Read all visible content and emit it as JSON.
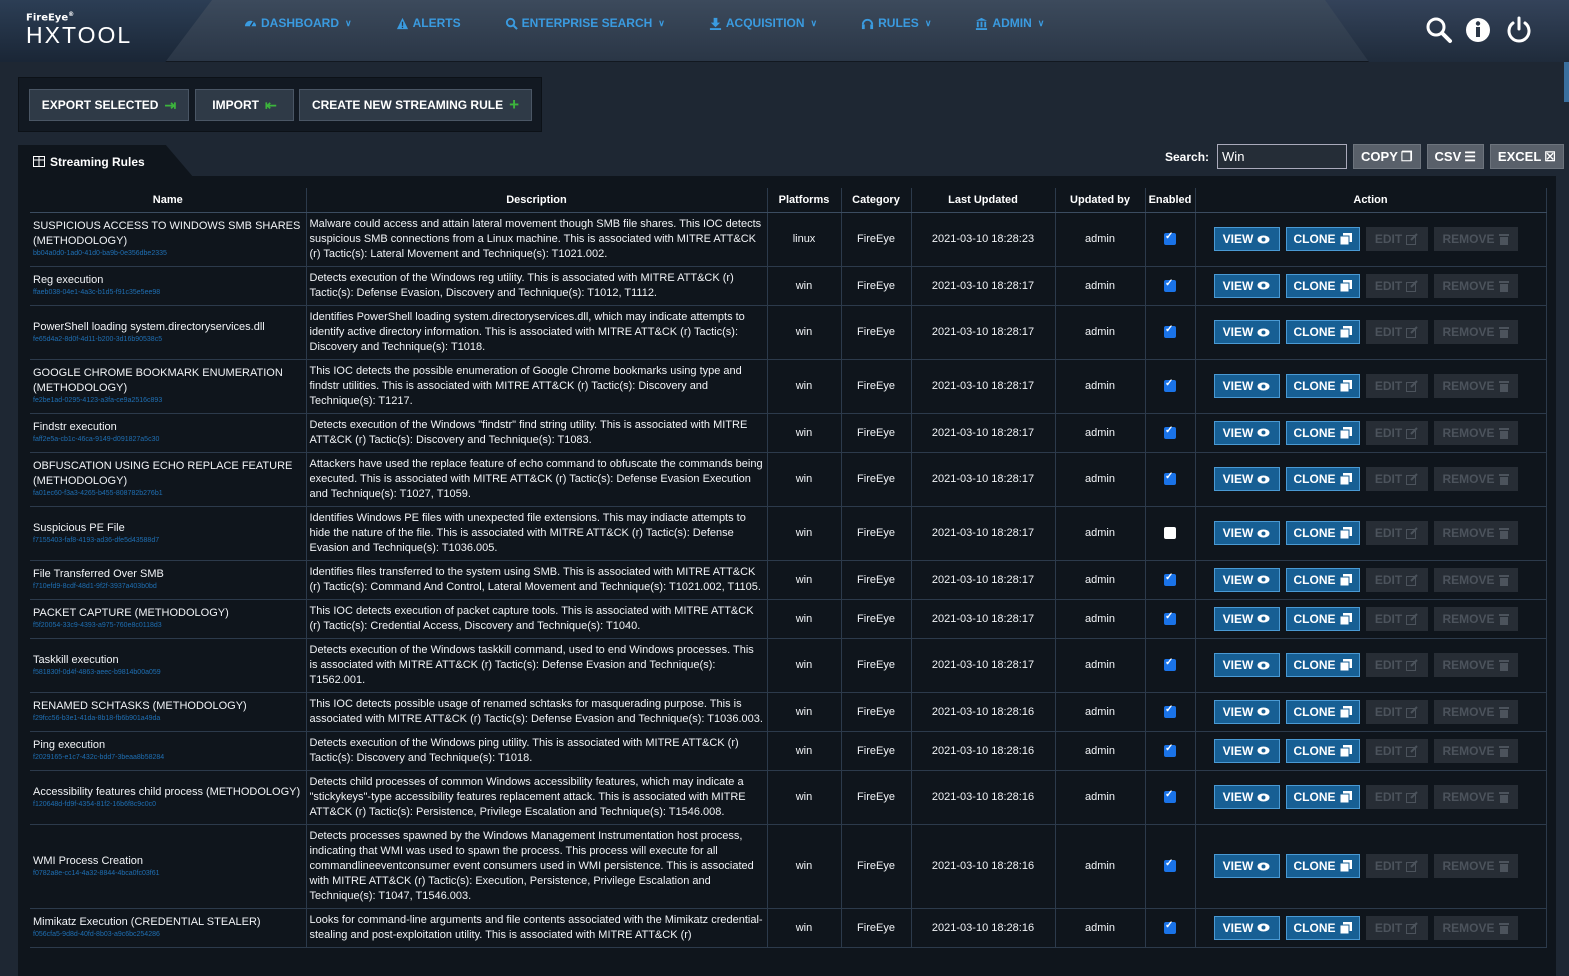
{
  "brand": {
    "vendor": "FireEye",
    "reg": "®",
    "product": "HXTOOL"
  },
  "nav": [
    {
      "label": "DASHBOARD",
      "icon": "dashboard-icon",
      "dropdown": true
    },
    {
      "label": "ALERTS",
      "icon": "warning-icon",
      "dropdown": false
    },
    {
      "label": "ENTERPRISE SEARCH",
      "icon": "search-icon",
      "dropdown": true
    },
    {
      "label": "ACQUISITION",
      "icon": "download-icon",
      "dropdown": true
    },
    {
      "label": "RULES",
      "icon": "headset-icon",
      "dropdown": true
    },
    {
      "label": "ADMIN",
      "icon": "bank-icon",
      "dropdown": true
    }
  ],
  "toolbar": {
    "export_label": "EXPORT SELECTED",
    "import_label": "IMPORT",
    "create_label": "CREATE NEW STREAMING RULE"
  },
  "panel": {
    "title": "Streaming Rules"
  },
  "search": {
    "label": "Search:",
    "value": "Win"
  },
  "export_buttons": {
    "copy": "COPY",
    "csv": "CSV",
    "excel": "EXCEL"
  },
  "columns": [
    "Name",
    "Description",
    "Platforms",
    "Category",
    "Last Updated",
    "Updated by",
    "Enabled",
    "Action"
  ],
  "actions": {
    "view": "VIEW",
    "clone": "CLONE",
    "edit": "EDIT",
    "remove": "REMOVE"
  },
  "colors": {
    "accent": "#3a9be0",
    "primary_button": "#175f94",
    "green_icon": "#3cb43c"
  },
  "rows": [
    {
      "name": "SUSPICIOUS ACCESS TO WINDOWS SMB SHARES (METHODOLOGY)",
      "id": "bb04a0d0-1ad0-41d0-ba9b-0e356dbe2335",
      "description": "Malware could access and attain lateral movement though SMB file shares. This IOC detects suspicious SMB connections from a Linux machine. This is associated with MITRE ATT&CK (r) Tactic(s): Lateral Movement and Technique(s): T1021.002.",
      "platform": "linux",
      "category": "FireEye",
      "updated": "2021-03-10 18:28:23",
      "by": "admin",
      "enabled": true
    },
    {
      "name": "Reg execution",
      "id": "ffaeb038-04e1-4a3c-b1d5-f91c35e5ee98",
      "description": "Detects execution of the Windows reg utility. This is associated with MITRE ATT&CK (r) Tactic(s): Defense Evasion, Discovery and Technique(s): T1012, T1112.",
      "platform": "win",
      "category": "FireEye",
      "updated": "2021-03-10 18:28:17",
      "by": "admin",
      "enabled": true
    },
    {
      "name": "PowerShell loading system.directoryservices.dll",
      "id": "fe65d4a2-8d0f-4d11-b200-3d16b90538c5",
      "description": "Identifies PowerShell loading system.directoryservices.dll, which may indicate attempts to identify active directory information. This is associated with MITRE ATT&CK (r) Tactic(s): Discovery and Technique(s): T1018.",
      "platform": "win",
      "category": "FireEye",
      "updated": "2021-03-10 18:28:17",
      "by": "admin",
      "enabled": true
    },
    {
      "name": "GOOGLE CHROME BOOKMARK ENUMERATION (METHODOLOGY)",
      "id": "fe2be1ad-0295-4123-a3fa-ce9a2516c893",
      "description": "This IOC detects the possible enumeration of Google Chrome bookmarks using type and findstr utilities. This is associated with MITRE ATT&CK (r) Tactic(s): Discovery and Technique(s): T1217.",
      "platform": "win",
      "category": "FireEye",
      "updated": "2021-03-10 18:28:17",
      "by": "admin",
      "enabled": true
    },
    {
      "name": "Findstr execution",
      "id": "faff2e5a-cb1c-46ca-9149-d091827a5c30",
      "description": "Detects execution of the Windows \"findstr\" find string utility. This is associated with MITRE ATT&CK (r) Tactic(s): Discovery and Technique(s): T1083.",
      "platform": "win",
      "category": "FireEye",
      "updated": "2021-03-10 18:28:17",
      "by": "admin",
      "enabled": true
    },
    {
      "name": "OBFUSCATION USING ECHO REPLACE FEATURE (METHODOLOGY)",
      "id": "fa01ec60-f3a3-4265-b455-808782b276b1",
      "description": "Attackers have used the replace feature of echo command to obfuscate the commands being executed. This is associated with MITRE ATT&CK (r) Tactic(s): Defense Evasion Execution and Technique(s): T1027, T1059.",
      "platform": "win",
      "category": "FireEye",
      "updated": "2021-03-10 18:28:17",
      "by": "admin",
      "enabled": true
    },
    {
      "name": "Suspicious PE File",
      "id": "f7155403-faf8-4193-ad36-dfe5d43588d7",
      "description": "Identifies Windows PE files with unexpected file extensions. This may indiacte attempts to hide the nature of the file. This is associated with MITRE ATT&CK (r) Tactic(s): Defense Evasion and Technique(s): T1036.005.",
      "platform": "win",
      "category": "FireEye",
      "updated": "2021-03-10 18:28:17",
      "by": "admin",
      "enabled": false
    },
    {
      "name": "File Transferred Over SMB",
      "id": "f710efd9-8cdf-48d1-9f2f-3937a403b0bd",
      "description": "Identifies files transferred to the system using SMB. This is associated with MITRE ATT&CK (r) Tactic(s): Command And Control, Lateral Movement and Technique(s): T1021.002, T1105.",
      "platform": "win",
      "category": "FireEye",
      "updated": "2021-03-10 18:28:17",
      "by": "admin",
      "enabled": true
    },
    {
      "name": "PACKET CAPTURE (METHODOLOGY)",
      "id": "f5f20054-33c9-4393-a975-760e8c0118d3",
      "description": "This IOC detects execution of packet capture tools. This is associated with MITRE ATT&CK (r) Tactic(s): Credential Access, Discovery and Technique(s): T1040.",
      "platform": "win",
      "category": "FireEye",
      "updated": "2021-03-10 18:28:17",
      "by": "admin",
      "enabled": true
    },
    {
      "name": "Taskkill execution",
      "id": "f581830f-0d4f-4863-aeec-b9814b00a059",
      "description": "Detects execution of the Windows taskkill command, used to end Windows processes. This is associated with MITRE ATT&CK (r) Tactic(s): Defense Evasion and Technique(s): T1562.001.",
      "platform": "win",
      "category": "FireEye",
      "updated": "2021-03-10 18:28:17",
      "by": "admin",
      "enabled": true
    },
    {
      "name": "RENAMED SCHTASKS (METHODOLOGY)",
      "id": "f29fcc56-b3e1-41da-8b18-fb6b901a49da",
      "description": "This IOC detects possible usage of renamed schtasks for masquerading purpose. This is associated with MITRE ATT&CK (r) Tactic(s): Defense Evasion and Technique(s): T1036.003.",
      "platform": "win",
      "category": "FireEye",
      "updated": "2021-03-10 18:28:16",
      "by": "admin",
      "enabled": true
    },
    {
      "name": "Ping execution",
      "id": "f2029165-e1c7-432c-bdd7-3beaa8b58284",
      "description": "Detects execution of the Windows ping utility. This is associated with MITRE ATT&CK (r) Tactic(s): Discovery and Technique(s): T1018.",
      "platform": "win",
      "category": "FireEye",
      "updated": "2021-03-10 18:28:16",
      "by": "admin",
      "enabled": true
    },
    {
      "name": "Accessibility features child process (METHODOLOGY)",
      "id": "f120648d-fd9f-4354-81f2-16b6f8c9c0c0",
      "description": "Detects child processes of common Windows accessibility features, which may indicate a \"stickykeys\"-type accessibility features replacement attack. This is associated with MITRE ATT&CK (r) Tactic(s): Persistence, Privilege Escalation and Technique(s): T1546.008.",
      "platform": "win",
      "category": "FireEye",
      "updated": "2021-03-10 18:28:16",
      "by": "admin",
      "enabled": true
    },
    {
      "name": "WMI Process Creation",
      "id": "f0782a8e-cc14-4a32-8844-4bca0fc03f61",
      "description": "Detects processes spawned by the Windows Management Instrumentation host process, indicating that WMI was used to spawn the process. This process will execute for all commandlineeventconsumer event consumers used in WMI persistence. This is associated with MITRE ATT&CK (r) Tactic(s): Execution, Persistence, Privilege Escalation and Technique(s): T1047, T1546.003.",
      "platform": "win",
      "category": "FireEye",
      "updated": "2021-03-10 18:28:16",
      "by": "admin",
      "enabled": true
    },
    {
      "name": "Mimikatz Execution (CREDENTIAL STEALER)",
      "id": "f056cfa5-9d8d-40fd-8b03-a9c6bc254286",
      "description": "Looks for command-line arguments and file contents associated with the Mimikatz credential-stealing and post-exploitation utility. This is associated with MITRE ATT&CK (r)",
      "platform": "win",
      "category": "FireEye",
      "updated": "2021-03-10 18:28:16",
      "by": "admin",
      "enabled": true
    }
  ]
}
